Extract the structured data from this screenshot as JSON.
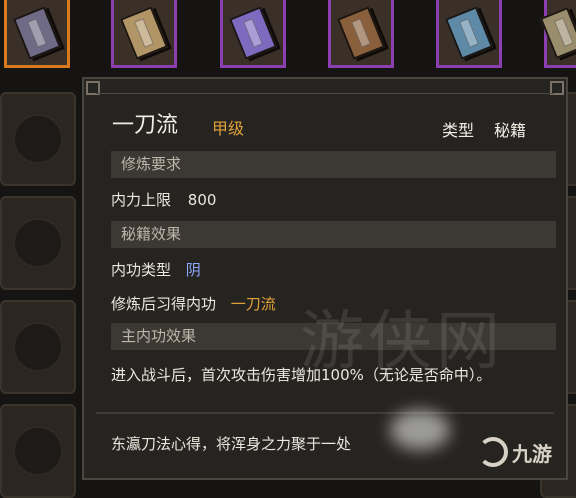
{
  "books": [
    {
      "name": "book-slot-1",
      "color": "#6f6a86",
      "selected": true
    },
    {
      "name": "book-slot-2",
      "color": "#b29566",
      "selected": false
    },
    {
      "name": "book-slot-3",
      "color": "#7e6bc0",
      "selected": false
    },
    {
      "name": "book-slot-4",
      "color": "#8a5f3b",
      "selected": false
    },
    {
      "name": "book-slot-5",
      "color": "#5e8aa8",
      "selected": false
    },
    {
      "name": "book-slot-6",
      "color": "#9a8d6c",
      "selected": false
    }
  ],
  "tooltip": {
    "title": "一刀流",
    "grade": "甲级",
    "type_label": "类型",
    "type_value": "秘籍",
    "sections": {
      "requirements": "修炼要求",
      "book_effect": "秘籍效果",
      "main_effect": "主内功效果"
    },
    "requirement": {
      "label": "内力上限",
      "value": "800"
    },
    "internal_type": {
      "label": "内功类型",
      "value": "阴"
    },
    "learn": {
      "label": "修炼后习得内功",
      "value": "一刀流"
    },
    "effect_text": "进入战斗后，首次攻击伤害增加100%（无论是否命中）。",
    "flavor_text": "东瀛刀法心得，将浑身之力聚于一处"
  },
  "watermark": "游侠网",
  "logo_text": "九游"
}
